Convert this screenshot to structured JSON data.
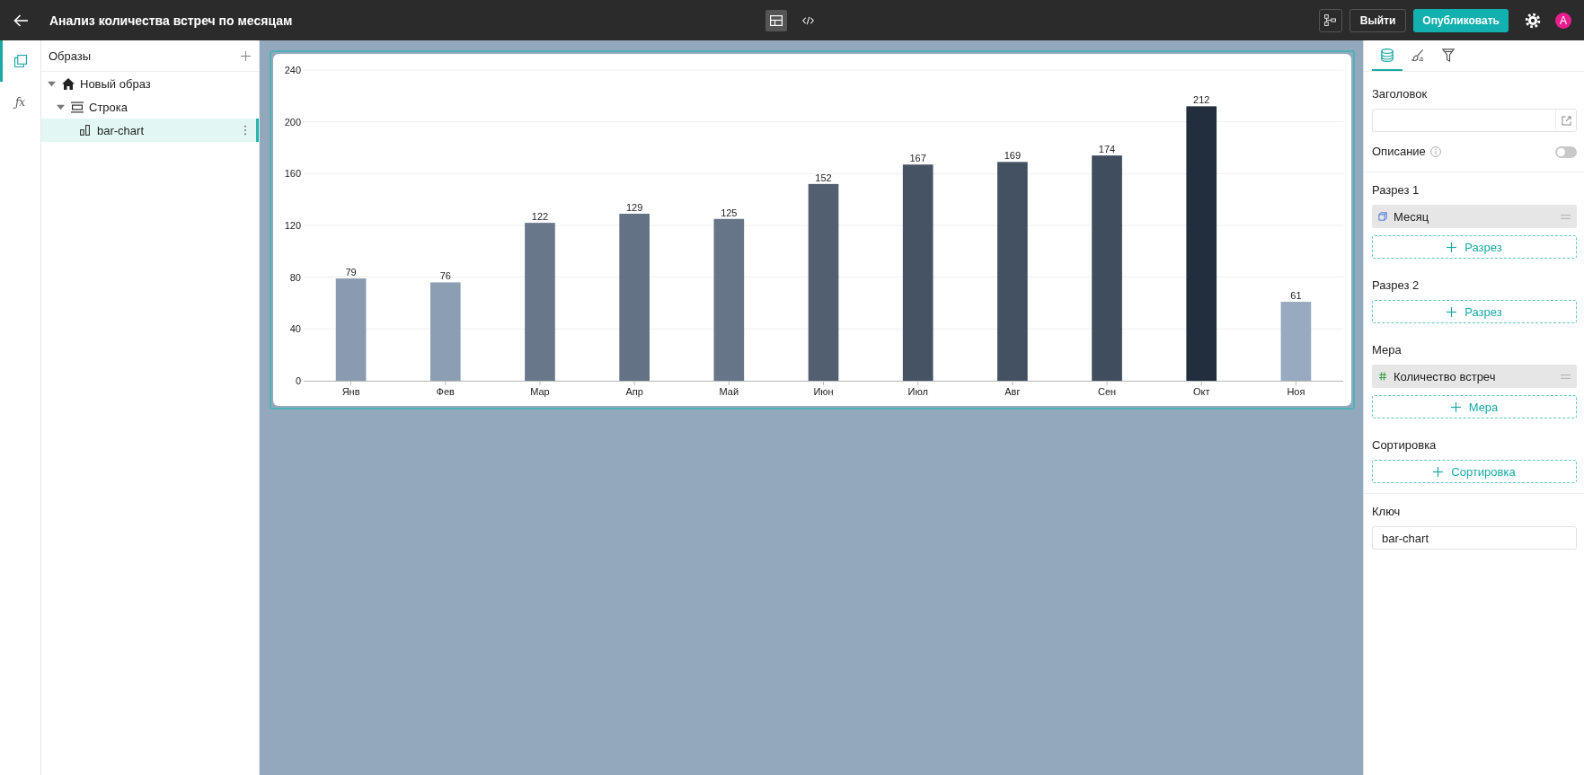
{
  "top_bar": {
    "title": "Анализ количества встреч по месяцам",
    "view_modes": [
      {
        "kind": "layout",
        "selected": true
      },
      {
        "kind": "code",
        "selected": false
      }
    ],
    "exit_button": "Выйти",
    "publish_button": "Опубликовать",
    "avatar": "A"
  },
  "left_rail": [
    {
      "kind": "pages",
      "selected": true
    },
    {
      "kind": "formula",
      "label": "ƒx",
      "selected": false
    }
  ],
  "tree_panel": {
    "title": "Образы",
    "tree": [
      {
        "label": "Новый образ",
        "kind": "home",
        "expanded": true,
        "selected": false,
        "children": [
          {
            "label": "Строка",
            "kind": "row",
            "expanded": true,
            "selected": false,
            "children": [
              {
                "label": "bar-chart",
                "kind": "chart",
                "selected": true
              }
            ]
          }
        ]
      }
    ]
  },
  "canvas": {
    "chart": {
      "selected": true,
      "chart_data": {
        "type": "bar",
        "categories": [
          "Янв",
          "Фев",
          "Мар",
          "Апр",
          "Май",
          "Июн",
          "Июл",
          "Авг",
          "Сен",
          "Окт",
          "Ноя"
        ],
        "series": [
          {
            "values": [
              79,
              76,
              122,
              129,
              125,
              152,
              167,
              169,
              174,
              212,
              61
            ]
          }
        ],
        "ylim": [
          0,
          240
        ],
        "yticks": [
          0,
          40,
          80,
          120,
          160,
          200,
          240
        ],
        "grid": true,
        "data_labels": true
      }
    }
  },
  "right_panel": {
    "tabs": [
      {
        "kind": "data",
        "selected": true
      },
      {
        "kind": "style",
        "selected": false
      },
      {
        "kind": "filter",
        "selected": false
      }
    ],
    "title_field": {
      "label": "Заголовок"
    },
    "description": {
      "label": "Описание",
      "on": false
    },
    "sections": [
      {
        "label": "Разрез 1",
        "items": [
          {
            "kind": "dimension",
            "label": "Месяц"
          }
        ],
        "add_button": "Разрез"
      },
      {
        "label": "Разрез 2",
        "add_button": "Разрез"
      },
      {
        "label": "Мера",
        "items": [
          {
            "kind": "measure",
            "label": "Количество встреч"
          }
        ],
        "add_button": "Мера"
      },
      {
        "label": "Сортировка",
        "add_button": "Сортировка"
      }
    ],
    "key_field": {
      "label": "Ключ",
      "value": "bar-chart"
    }
  }
}
